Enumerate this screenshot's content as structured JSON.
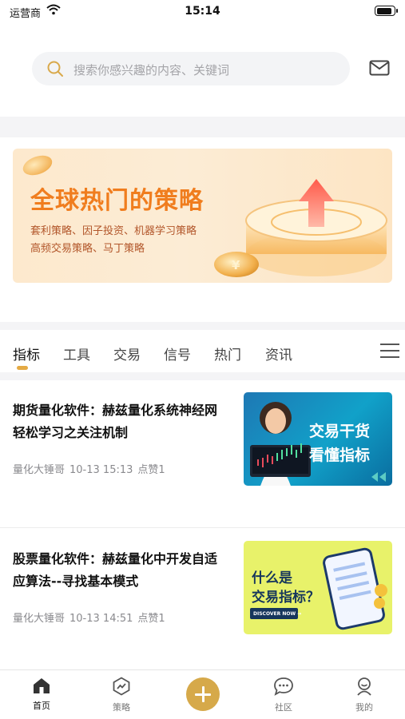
{
  "status_bar": {
    "carrier": "运营商",
    "time": "15:14",
    "battery_level": 0.9
  },
  "search": {
    "placeholder": "搜索你感兴趣的内容、关键词"
  },
  "banner": {
    "title": "全球热门的策略",
    "line1": "套利策略、因子投资、机器学习策略",
    "line2": "高频交易策略、马丁策略"
  },
  "tabs": [
    {
      "label": "指标",
      "active": true
    },
    {
      "label": "工具"
    },
    {
      "label": "交易"
    },
    {
      "label": "信号"
    },
    {
      "label": "热门"
    },
    {
      "label": "资讯"
    }
  ],
  "articles": [
    {
      "title": "期货量化软件：赫兹量化系统神经网轻松学习之关注机制",
      "author": "量化大锤哥",
      "time": "10-13 15:13",
      "likes": "点赞1",
      "thumb_line1": "交易干货",
      "thumb_line2": "看懂指标"
    },
    {
      "title": "股票量化软件：赫兹量化中开发自适应算法--寻找基本模式",
      "author": "量化大锤哥",
      "time": "10-13 14:51",
      "likes": "点赞1",
      "thumb_line1": "什么是",
      "thumb_line2": "交易指标？",
      "thumb_button": "DISCOVER NOW →"
    }
  ],
  "nav": [
    {
      "label": "首页",
      "icon": "home-icon",
      "active": true
    },
    {
      "label": "策略",
      "icon": "strategy-icon"
    },
    {
      "label": "",
      "icon": "plus-icon"
    },
    {
      "label": "社区",
      "icon": "community-icon"
    },
    {
      "label": "我的",
      "icon": "profile-icon"
    }
  ],
  "colors": {
    "accent": "#d6a94a",
    "tab_indicator": "#e4aa44",
    "banner_title": "#f07d1e"
  }
}
